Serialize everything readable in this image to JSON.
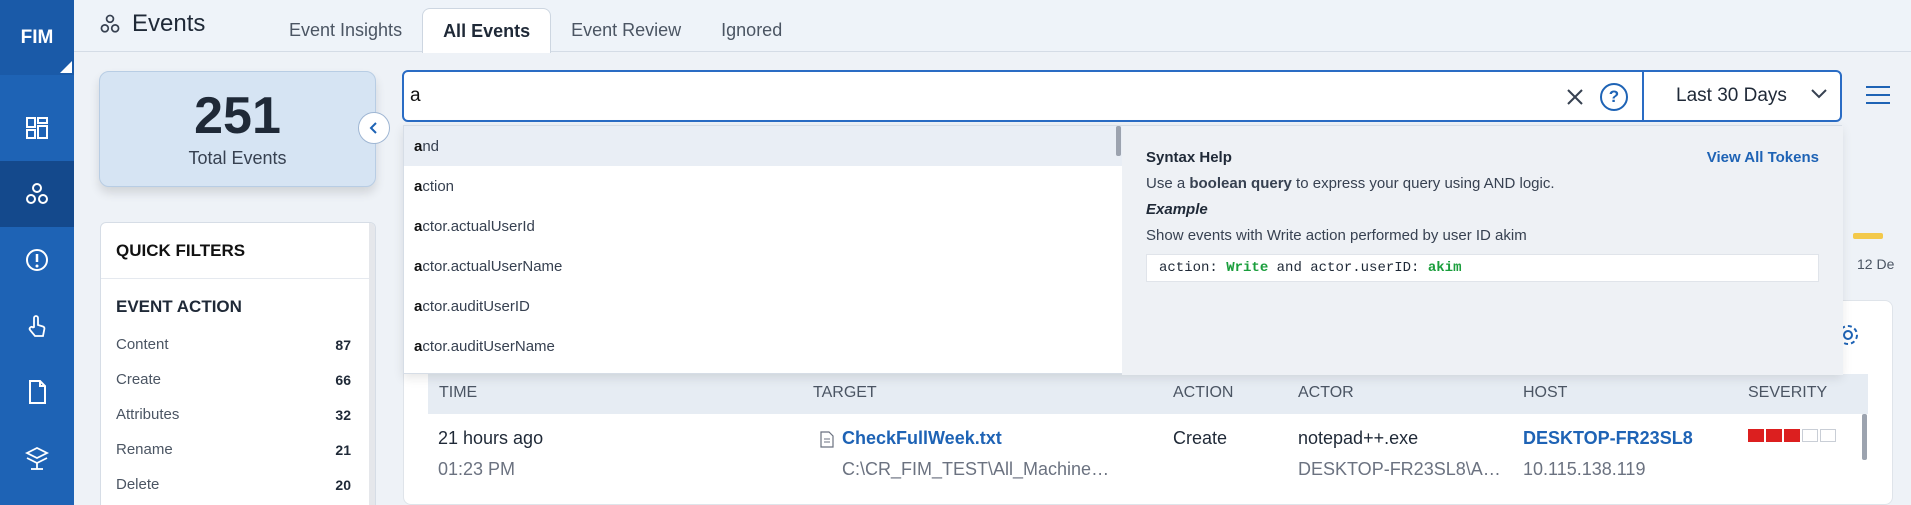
{
  "app": {
    "logo": "FIM",
    "page_title": "Events"
  },
  "sidebar": {
    "items": [
      {
        "icon": "dashboard-icon"
      },
      {
        "icon": "events-icon",
        "active": true
      },
      {
        "icon": "alert-icon"
      },
      {
        "icon": "touch-icon"
      },
      {
        "icon": "document-icon"
      },
      {
        "icon": "network-icon"
      }
    ]
  },
  "tabs": [
    {
      "label": "Event Insights"
    },
    {
      "label": "All Events",
      "active": true
    },
    {
      "label": "Event Review"
    },
    {
      "label": "Ignored"
    }
  ],
  "summary": {
    "total": "251",
    "label": "Total Events"
  },
  "quick_filters": {
    "title": "QUICK FILTERS",
    "section": "EVENT ACTION",
    "items": [
      {
        "label": "Content",
        "count": "87"
      },
      {
        "label": "Create",
        "count": "66"
      },
      {
        "label": "Attributes",
        "count": "32"
      },
      {
        "label": "Rename",
        "count": "21"
      },
      {
        "label": "Delete",
        "count": "20"
      }
    ]
  },
  "search": {
    "value": "a",
    "date_range": "Last 30 Days"
  },
  "suggestions": [
    {
      "match": "a",
      "rest": "nd"
    },
    {
      "match": "a",
      "rest": "ction"
    },
    {
      "match": "a",
      "rest": "ctor.actualUserId"
    },
    {
      "match": "a",
      "rest": "ctor.actualUserName"
    },
    {
      "match": "a",
      "rest": "ctor.auditUserID"
    },
    {
      "match": "a",
      "rest": "ctor.auditUserName"
    }
  ],
  "syntax_help": {
    "title": "Syntax Help",
    "link": "View All Tokens",
    "desc_pre": "Use a ",
    "desc_bold": "boolean query",
    "desc_post": " to express your query using AND logic.",
    "example_label": "Example",
    "example_desc": "Show events with Write action performed by user ID akim",
    "code_k1": "action: ",
    "code_v1": "Write",
    "code_mid": " and actor.userID: ",
    "code_v2": "akim"
  },
  "chart_hint": {
    "label": "12 De",
    "color": "#f3c94b"
  },
  "table": {
    "columns": [
      "TIME",
      "TARGET",
      "ACTION",
      "ACTOR",
      "HOST",
      "SEVERITY"
    ],
    "rows": [
      {
        "time": "21 hours ago",
        "time_sub": "01:23 PM",
        "target": "CheckFullWeek.txt",
        "target_sub": "C:\\CR_FIM_TEST\\All_Machine…",
        "action": "Create",
        "actor": "notepad++.exe",
        "actor_sub": "DESKTOP-FR23SL8\\A…",
        "host": "DESKTOP-FR23SL8",
        "host_sub": "10.115.138.119",
        "severity_level": 3,
        "severity_max": 5
      }
    ]
  },
  "colors": {
    "brand": "#1e63b5",
    "severity": "#dc1f1f",
    "accent": "#2a6cc4"
  }
}
